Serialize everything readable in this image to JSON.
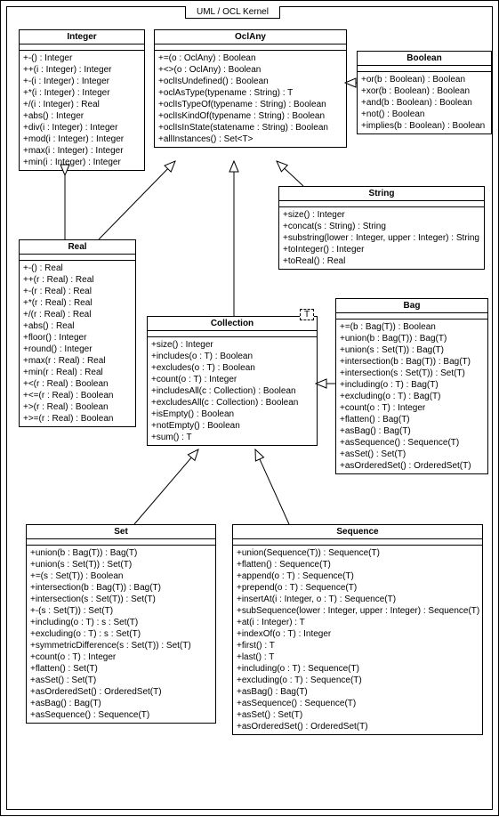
{
  "diagram": {
    "title": "UML / OCL Kernel",
    "Integer": {
      "name": "Integer",
      "ops": [
        "+-() : Integer",
        "++(i : Integer) : Integer",
        "+-(i : Integer) : Integer",
        "+*(i : Integer) : Integer",
        "+/(i : Integer) : Real",
        "+abs() : Integer",
        "+div(i : Integer) : Integer",
        "+mod(i : Integer) : Integer",
        "+max(i : Integer) : Integer",
        "+min(i : Integer) : Integer"
      ]
    },
    "OclAny": {
      "name": "OclAny",
      "ops": [
        "+=(o : OclAny) : Boolean",
        "+<>(o : OclAny) : Boolean",
        "+oclIsUndefined() : Boolean",
        "+oclAsType(typename : String) : T",
        "+oclIsTypeOf(typename : String) : Boolean",
        "+oclIsKindOf(typename : String) : Boolean",
        "+oclIsInState(statename : String) : Boolean",
        "+allInstances() : Set<T>"
      ]
    },
    "Boolean": {
      "name": "Boolean",
      "ops": [
        "+or(b : Boolean) : Boolean",
        "+xor(b : Boolean) : Boolean",
        "+and(b : Boolean) : Boolean",
        "+not() : Boolean",
        "+implies(b : Boolean) : Boolean"
      ]
    },
    "String": {
      "name": "String",
      "ops": [
        "+size() : Integer",
        "+concat(s : String) : String",
        "+substring(lower : Integer, upper : Integer) : String",
        "+toInteger() : Integer",
        "+toReal() : Real"
      ]
    },
    "Real": {
      "name": "Real",
      "ops": [
        "+-() : Real",
        "++(r : Real) : Real",
        "+-(r : Real) : Real",
        "+*(r : Real) : Real",
        "+/(r : Real) : Real",
        "+abs() : Real",
        "+floor() : Integer",
        "+round() : Integer",
        "+max(r : Real) : Real",
        "+min(r : Real) : Real",
        "+<(r : Real) : Boolean",
        "+<=(r : Real) : Boolean",
        "+>(r : Real) : Boolean",
        "+>=(r : Real) : Boolean"
      ]
    },
    "Collection": {
      "name": "Collection",
      "template": "T",
      "ops": [
        "+size() : Integer",
        "+includes(o : T) : Boolean",
        "+excludes(o : T) : Boolean",
        "+count(o : T) : Integer",
        "+includesAll(c : Collection) : Boolean",
        "+excludesAll(c : Collection) : Boolean",
        "+isEmpty() : Boolean",
        "+notEmpty() : Boolean",
        "+sum() : T"
      ]
    },
    "Bag": {
      "name": "Bag",
      "ops": [
        "+=(b : Bag(T)) : Boolean",
        "+union(b : Bag(T)) : Bag(T)",
        "+union(s : Set(T)) : Bag(T)",
        "+intersection(b : Bag(T)) : Bag(T)",
        "+intersection(s : Set(T)) : Set(T)",
        "+including(o : T) : Bag(T)",
        "+excluding(o : T) : Bag(T)",
        "+count(o : T) : Integer",
        "+flatten() : Bag(T)",
        "+asBag() : Bag(T)",
        "+asSequence() : Sequence(T)",
        "+asSet() : Set(T)",
        "+asOrderedSet() : OrderedSet(T)"
      ]
    },
    "Set": {
      "name": "Set",
      "ops": [
        "+union(b : Bag(T)) : Bag(T)",
        "+union(s : Set(T)) : Set(T)",
        "+=(s : Set(T)) : Boolean",
        "+intersection(b : Bag(T)) : Bag(T)",
        "+intersection(s : Set(T)) : Set(T)",
        "+-(s : Set(T)) : Set(T)",
        "+including(o : T) : s : Set(T)",
        "+excluding(o : T) : s : Set(T)",
        "+symmetricDifference(s : Set(T)) : Set(T)",
        "+count(o : T) : Integer",
        "+flatten() : Set(T)",
        "+asSet() : Set(T)",
        "+asOrderedSet() : OrderedSet(T)",
        "+asBag() : Bag(T)",
        "+asSequence() : Sequence(T)"
      ]
    },
    "Sequence": {
      "name": "Sequence",
      "ops": [
        "+union(Sequence(T)) : Sequence(T)",
        "+flatten() : Sequence(T)",
        "+append(o : T) : Sequence(T)",
        "+prepend(o : T) : Sequence(T)",
        "+insertAt(i : Integer, o : T) : Sequence(T)",
        "+subSequence(lower : Integer, upper : Integer) : Sequence(T)",
        "+at(i : Integer) : T",
        "+indexOf(o : T) : Integer",
        "+first() : T",
        "+last() : T",
        "+including(o : T) : Sequence(T)",
        "+excluding(o : T) : Sequence(T)",
        "+asBag() : Bag(T)",
        "+asSequence() : Sequence(T)",
        "+asSet() : Set(T)",
        "+asOrderedSet() : OrderedSet(T)"
      ]
    }
  }
}
